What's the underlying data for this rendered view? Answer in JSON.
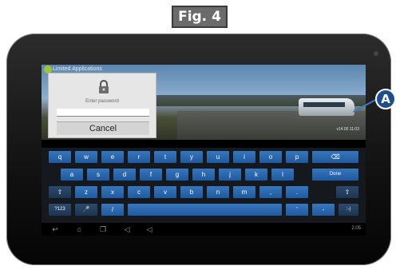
{
  "figure": {
    "label": "Fig. 4",
    "callout": "A"
  },
  "app": {
    "title": "Limited Applications"
  },
  "video": {
    "timestamp": "v14.00 11:03"
  },
  "dialog": {
    "prompt": "Enter password",
    "password_value": "",
    "cancel_label": "Cancel",
    "icon": "lock-icon"
  },
  "keyboard": {
    "row1": [
      "q",
      "w",
      "e",
      "r",
      "t",
      "y",
      "u",
      "i",
      "o",
      "p",
      "⌫"
    ],
    "row2": [
      "a",
      "s",
      "d",
      "f",
      "g",
      "h",
      "j",
      "k",
      "l",
      "Done"
    ],
    "row3": [
      "⇧",
      "z",
      "x",
      "c",
      "v",
      "b",
      "n",
      "m",
      ",",
      ".",
      "⇧"
    ],
    "row4": [
      "?123",
      "🎤",
      "/",
      "",
      "'",
      "-",
      ":-)"
    ]
  },
  "status": {
    "time": "2:05"
  },
  "colors": {
    "key_blue": "#2a68ae",
    "callout_blue": "#1f4e8f"
  }
}
